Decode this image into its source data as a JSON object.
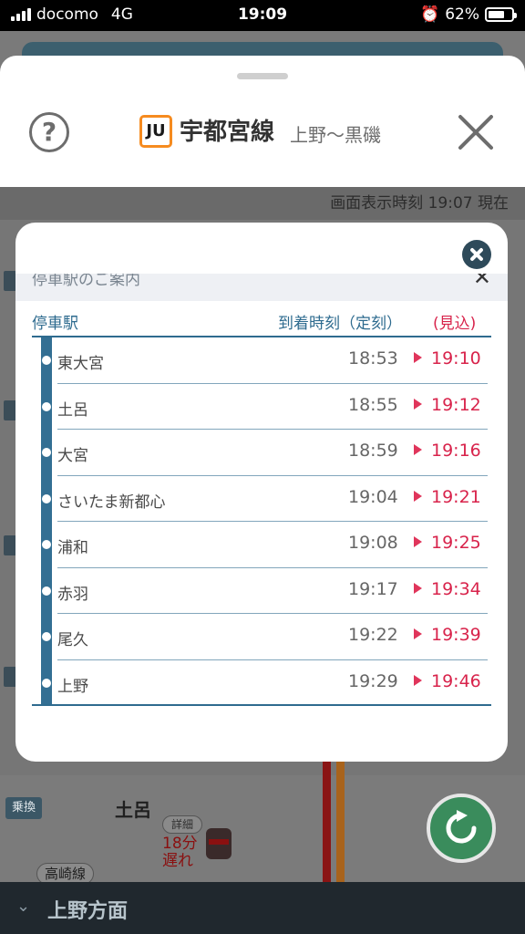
{
  "status_bar": {
    "carrier": "docomo",
    "network": "4G",
    "time": "19:09",
    "battery": "62%"
  },
  "header": {
    "line_code": "JU",
    "line_name": "宇都宮線",
    "line_range": "上野〜黒磯",
    "accent_color": "#f68b1f"
  },
  "display_time": "画面表示時刻 19:07 現在",
  "modal": {
    "section_title": "停車駅のご案内",
    "columns": {
      "station": "停車駅",
      "arrival": "到着時刻（定刻）",
      "estimated": "(見込)"
    },
    "stops": [
      {
        "name": "東大宮",
        "scheduled": "18:53",
        "estimated": "19:10"
      },
      {
        "name": "土呂",
        "scheduled": "18:55",
        "estimated": "19:12"
      },
      {
        "name": "大宮",
        "scheduled": "18:59",
        "estimated": "19:16"
      },
      {
        "name": "さいたま新都心",
        "scheduled": "19:04",
        "estimated": "19:21"
      },
      {
        "name": "浦和",
        "scheduled": "19:08",
        "estimated": "19:25"
      },
      {
        "name": "赤羽",
        "scheduled": "19:17",
        "estimated": "19:34"
      },
      {
        "name": "尾久",
        "scheduled": "19:22",
        "estimated": "19:39"
      },
      {
        "name": "上野",
        "scheduled": "19:29",
        "estimated": "19:46"
      }
    ]
  },
  "background": {
    "transfer_label": "乗換",
    "station": "土呂",
    "detail_label": "詳細",
    "delay_line1": "18分",
    "delay_line2": "遅れ",
    "connecting_line": "高崎線"
  },
  "bottom_bar": {
    "direction": "上野方面"
  },
  "icons": {
    "help": "help-icon",
    "close": "close-icon",
    "refresh": "refresh-icon",
    "train": "train-icon",
    "chevron": "chevron-down-icon"
  }
}
